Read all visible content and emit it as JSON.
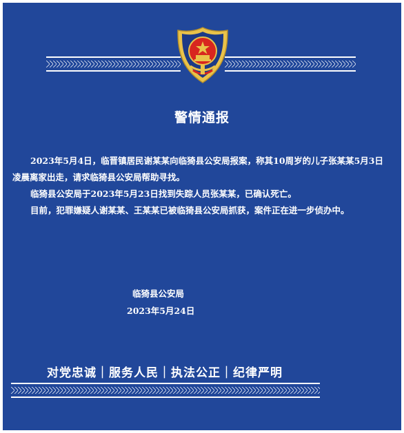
{
  "notice": {
    "title": "警情通报",
    "paragraphs": [
      "2023年5月4日，临晋镇居民谢某某向临猗县公安局报案，称其10周岁的儿子张某某5月3日凌晨离家出走，请求临猗县公安局帮助寻找。",
      "临猗县公安局于2023年5月23日找到失踪人员张某某，已确认死亡。",
      "目前，犯罪嫌疑人谢某某、王某某已被临猗县公安局抓获，案件正在进一步侦办中。"
    ],
    "signature_org": "临猗县公安局",
    "signature_date": "2023年5月24日",
    "slogan": "对党忠诚｜服务人民｜执法公正｜纪律严明"
  },
  "colors": {
    "background": "#21479a",
    "text": "#ffffff",
    "emblem_red": "#d8261f",
    "emblem_gold": "#e9c24a"
  },
  "icons": {
    "emblem": "police-emblem-icon"
  }
}
